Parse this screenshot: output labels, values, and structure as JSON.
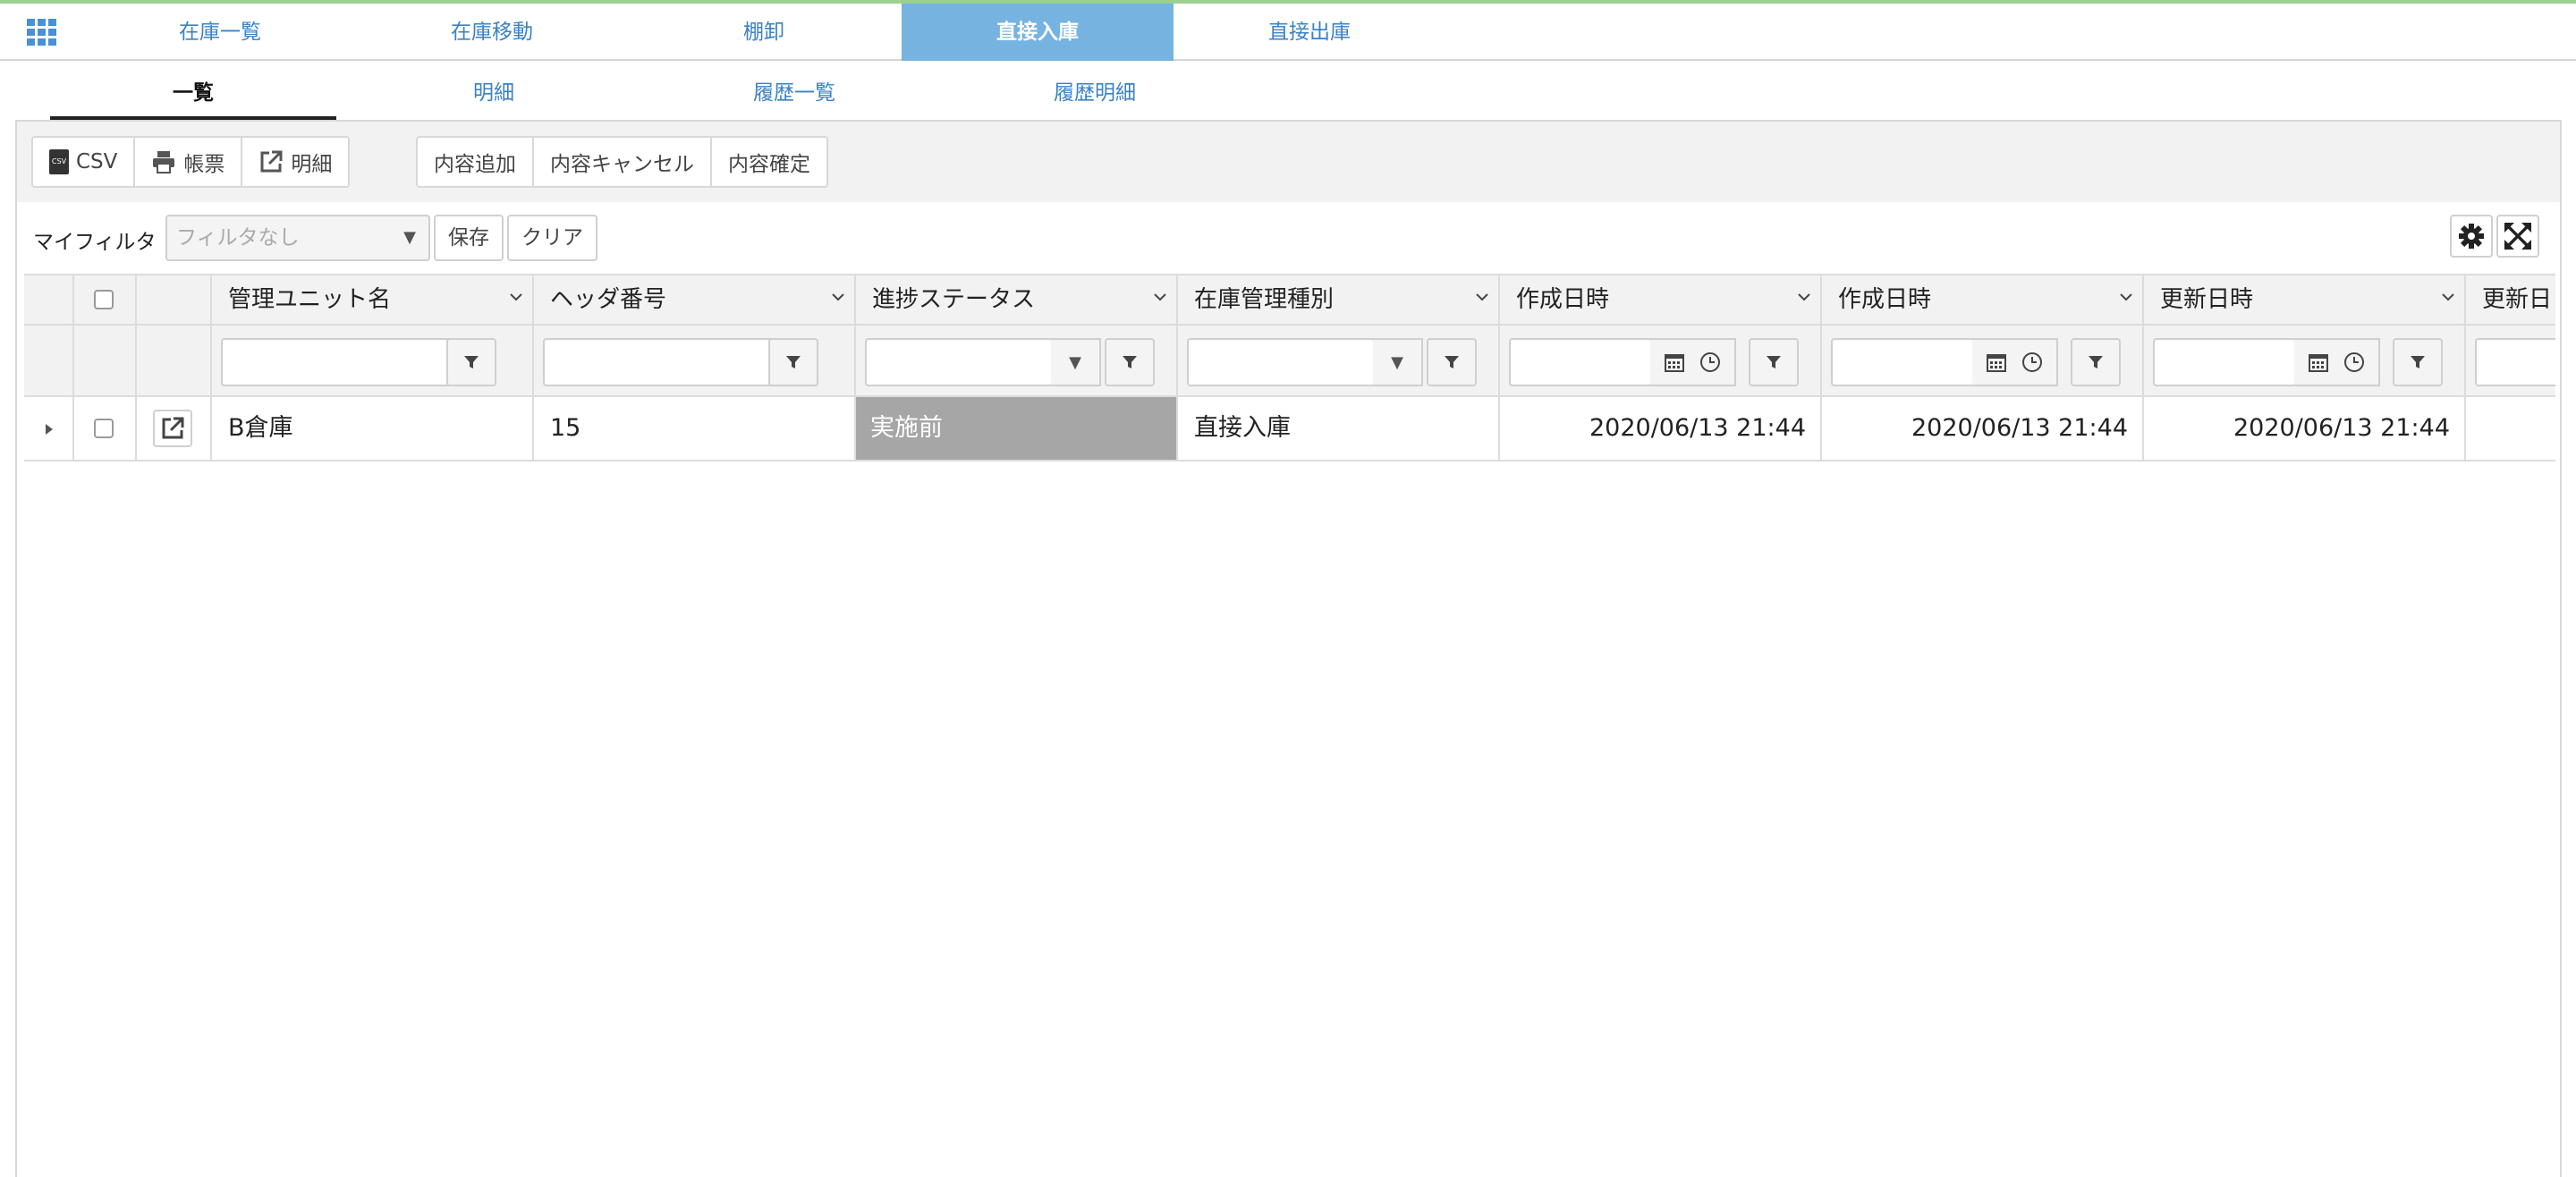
{
  "top_tabs": [
    "在庫一覧",
    "在庫移動",
    "棚卸",
    "直接入庫",
    "直接出庫"
  ],
  "active_top_tab": "直接入庫",
  "sub_tabs": [
    "一覧",
    "明細",
    "履歴一覧",
    "履歴明細"
  ],
  "active_sub_tab": "一覧",
  "toolbar": {
    "csv_icon_text": "CSV",
    "csv_label": "CSV",
    "report_label": "帳票",
    "detail_label": "明細",
    "add_label": "内容追加",
    "cancel_label": "内容キャンセル",
    "confirm_label": "内容確定"
  },
  "filter": {
    "label": "マイフィルタ",
    "placeholder": "フィルタなし",
    "save_label": "保存",
    "clear_label": "クリア"
  },
  "grid": {
    "headers": [
      "管理ユニット名",
      "ヘッダ番号",
      "進捗ステータス",
      "在庫管理種別",
      "作成日時",
      "作成日時",
      "更新日時",
      "更新日"
    ],
    "row": {
      "unit_name": "B倉庫",
      "header_no": "15",
      "status": "実施前",
      "type": "直接入庫",
      "created_1": "2020/06/13 21:44",
      "created_2": "2020/06/13 21:44",
      "updated": "2020/06/13 21:44"
    }
  },
  "colors": {
    "active_tab_bg": "#76b3e0",
    "link": "#3b82c4",
    "status_bg": "#a6a6a6",
    "top_line": "#9bd08e"
  }
}
